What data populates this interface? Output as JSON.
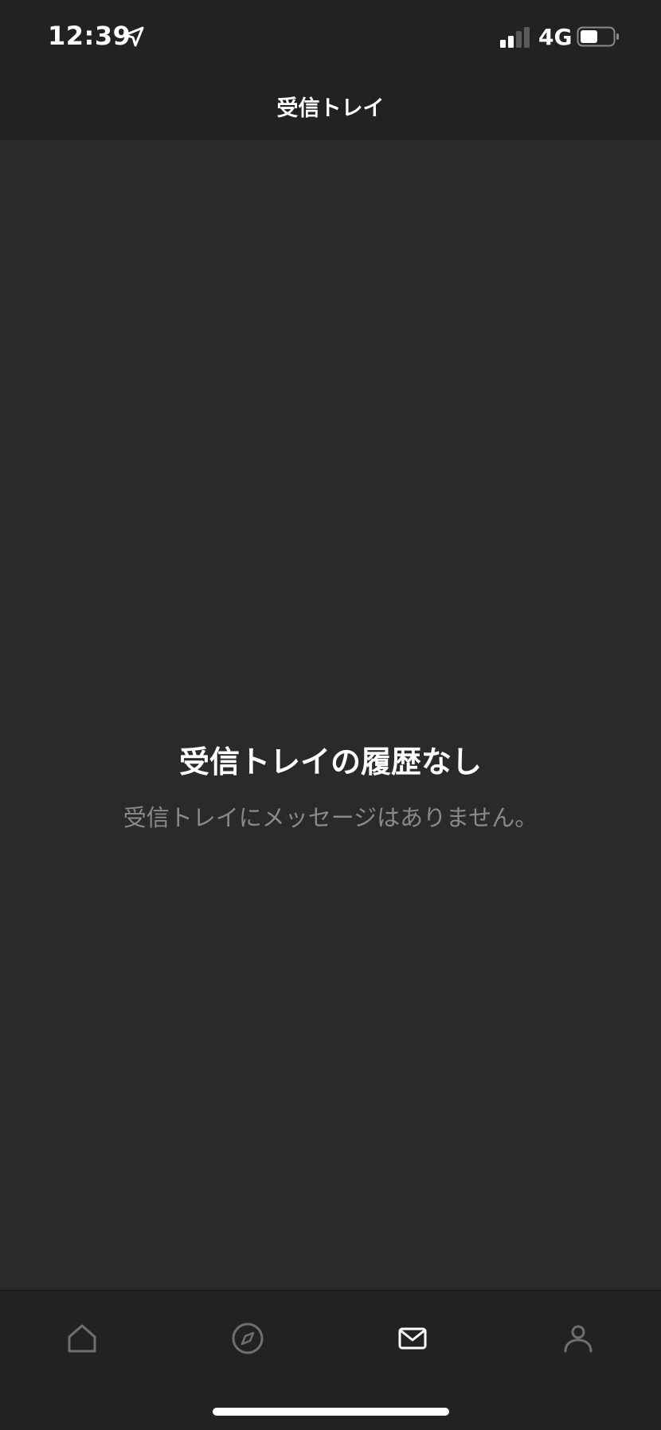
{
  "status_bar": {
    "time": "12:39",
    "network": "4G",
    "location_icon": "location-arrow-icon",
    "signal_icon": "cellular-signal-icon",
    "battery_icon": "battery-icon"
  },
  "header": {
    "title": "受信トレイ"
  },
  "empty_state": {
    "title": "受信トレイの履歴なし",
    "message": "受信トレイにメッセージはありません。"
  },
  "tab_bar": {
    "tabs": [
      {
        "icon": "home-icon",
        "active": false
      },
      {
        "icon": "compass-icon",
        "active": false
      },
      {
        "icon": "mail-icon",
        "active": true
      },
      {
        "icon": "person-icon",
        "active": false
      }
    ]
  },
  "colors": {
    "background": "#2a2a2a",
    "bars": "#222222",
    "text_primary": "#ffffff",
    "text_secondary": "#8a8a8a",
    "tab_inactive": "#6f6f6f",
    "tab_active": "#ffffff"
  }
}
